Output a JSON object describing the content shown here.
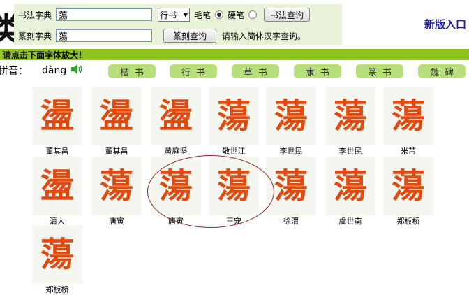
{
  "logo_char": "类",
  "search": {
    "calligraphy_label": "书法字典",
    "calligraphy_value": "蕩",
    "style_select": "行书",
    "brush_label": "毛笔",
    "hard_pen_label": "硬笔",
    "calligraphy_button": "书法查询",
    "seal_label": "篆刻字典",
    "seal_value": "蕩",
    "seal_button": "篆刻查询",
    "hint": "请输入简体汉字查询。"
  },
  "new_version_link": "新版入口",
  "notice": {
    "bold": "请点击",
    "rest": "下面字体放大！"
  },
  "pinyin": {
    "label": "拼音：",
    "value": "dàng"
  },
  "style_tabs": [
    "楷书",
    "行书",
    "草书",
    "隶书",
    "篆书",
    "魏碑"
  ],
  "glyphs": [
    {
      "char": "盪",
      "author": "董其昌"
    },
    {
      "char": "盪",
      "author": "董其昌"
    },
    {
      "char": "盪",
      "author": "黄庭坚"
    },
    {
      "char": "蕩",
      "author": "敬世江"
    },
    {
      "char": "蕩",
      "author": "李世民"
    },
    {
      "char": "蕩",
      "author": "李世民"
    },
    {
      "char": "蕩",
      "author": "米芾"
    },
    {
      "char": "盪",
      "author": "清人"
    },
    {
      "char": "蕩",
      "author": "唐寅"
    },
    {
      "char": "蕩",
      "author": "唐寅"
    },
    {
      "char": "蕩",
      "author": "王宠"
    },
    {
      "char": "蕩",
      "author": "徐渭"
    },
    {
      "char": "蕩",
      "author": "虞世南"
    },
    {
      "char": "蕩",
      "author": "郑板桥"
    },
    {
      "char": "蕩",
      "author": "郑板桥"
    }
  ],
  "colors": {
    "accent_green": "#8ec31e",
    "tab_green": "#b7df7a",
    "glyph_red": "#e14a0e",
    "link_blue": "#1c1c9c"
  },
  "icons": {
    "speaker": "speaker-icon"
  }
}
